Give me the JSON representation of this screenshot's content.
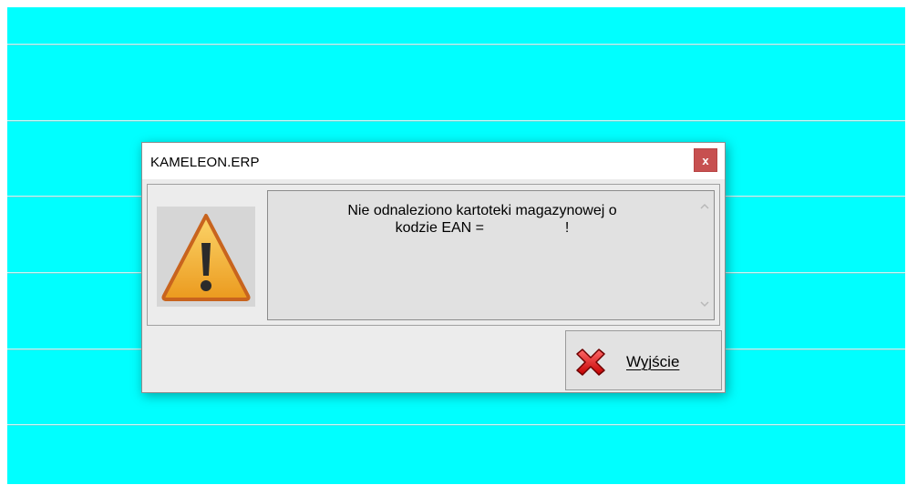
{
  "dialog": {
    "title": "KAMELEON.ERP",
    "close_label": "x",
    "message_line1": "Nie odnaleziono kartoteki magazynowej o",
    "message_line2": "kodzie EAN =                    !",
    "icon": "warning-icon",
    "exit_label": "Wyjście",
    "exit_icon": "red-x-icon"
  },
  "colors": {
    "desktop_background": "#00ffff",
    "close_button": "#c75050",
    "warning_yellow": "#f3b43c",
    "error_red": "#e02020"
  }
}
